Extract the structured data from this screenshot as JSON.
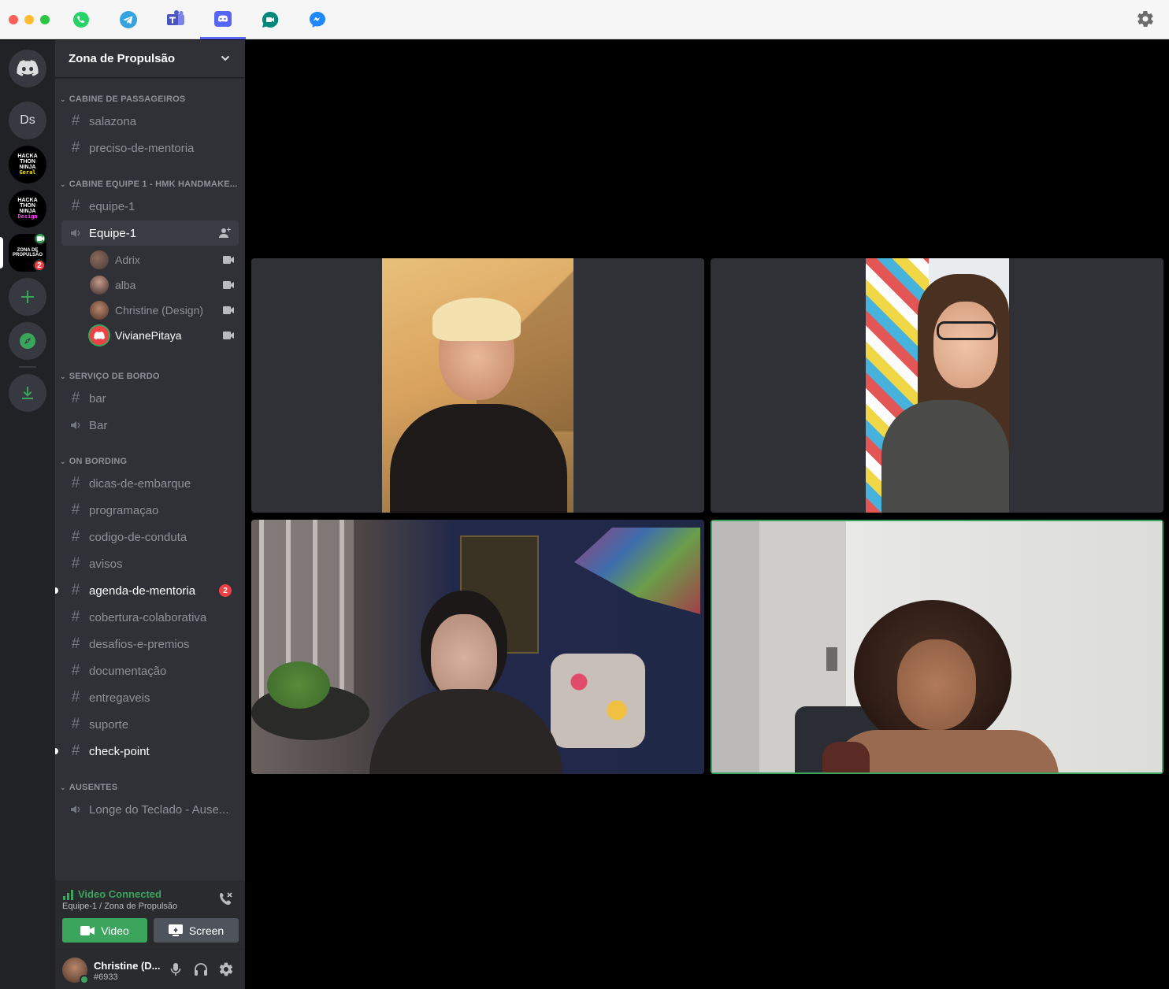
{
  "guild": {
    "name": "Zona de Propulsão"
  },
  "categories": {
    "c1": "CABINE DE PASSAGEIROS",
    "c2": "CABINE EQUIPE 1 - HMK HANDMAKE...",
    "c3": "SERVIÇO DE BORDO",
    "c4": "ON BORDING",
    "c5": "AUSENTES"
  },
  "channels": {
    "salazona": "salazona",
    "preciso": "preciso-de-mentoria",
    "equipe1_text": "equipe-1",
    "equipe1_voice": "Equipe-1",
    "bar_text": "bar",
    "bar_voice": "Bar",
    "dicas": "dicas-de-embarque",
    "programacao": "programaçao",
    "codigo": "codigo-de-conduta",
    "avisos": "avisos",
    "agenda": "agenda-de-mentoria",
    "agenda_badge": "2",
    "cobertura": "cobertura-colaborativa",
    "desafios": "desafios-e-premios",
    "documentacao": "documentação",
    "entregaveis": "entregaveis",
    "suporte": "suporte",
    "checkpoint": "check-point",
    "longe": "Longe do Teclado - Ause..."
  },
  "voice_users": [
    "Adrix",
    "alba",
    "Christine (Design)",
    "VivianePitaya"
  ],
  "servers": {
    "ds": "Ds",
    "geral_lines": [
      "HACKA",
      "THON",
      "NINJA",
      "Geral"
    ],
    "design_lines": [
      "HACKA",
      "THON",
      "NINJA",
      "Design"
    ],
    "zona_lines": [
      "ZONA DE",
      "PROPULSÃO"
    ],
    "zona_badge": "2"
  },
  "voice_panel": {
    "status": "Video Connected",
    "location": "Equipe-1 / Zona de Propulsão",
    "video_label": "Video",
    "screen_label": "Screen"
  },
  "user": {
    "name": "Christine (D...",
    "tag": "#6933"
  },
  "colors": {
    "accent": "#5865f2",
    "green": "#3ba55d",
    "red": "#ed4245"
  }
}
